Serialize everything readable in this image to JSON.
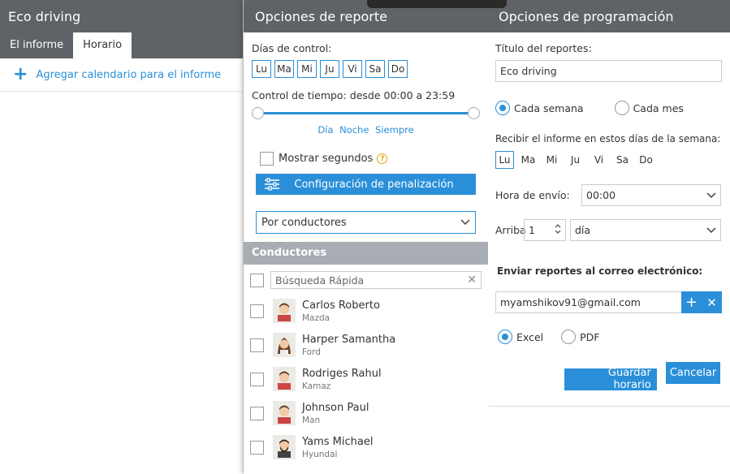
{
  "left": {
    "title": "Eco driving",
    "tabs": [
      {
        "label": "El informe"
      },
      {
        "label": "Horario"
      }
    ],
    "add_calendar": "Agregar calendario para el informe"
  },
  "report_options": {
    "title": "Opciones de reporte",
    "control_days_label": "Días de control:",
    "days": [
      "Lu",
      "Ma",
      "Mi",
      "Ju",
      "Vi",
      "Sa",
      "Do"
    ],
    "time_control": "Control de tiempo: desde 00:00 a 23:59",
    "modes": [
      "Día",
      "Noche",
      "Siempre"
    ],
    "show_seconds": "Mostrar segundos",
    "penalty_button": "Configuración de penalización",
    "group_by": "Por conductores",
    "drivers_header": "Conductores",
    "search_placeholder": "Búsqueda Rápida",
    "drivers": [
      {
        "name": "Carlos Roberto",
        "car": "Mazda"
      },
      {
        "name": "Harper Samantha",
        "car": "Ford"
      },
      {
        "name": "Rodriges Rahul",
        "car": "Kamaz"
      },
      {
        "name": "Johnson Paul",
        "car": "Man"
      },
      {
        "name": "Yams Michael",
        "car": "Hyundai"
      }
    ]
  },
  "schedule": {
    "title": "Opciones de programación",
    "report_title_label": "Título del reportes:",
    "report_title_value": "Eco driving",
    "every_week": "Cada semana",
    "every_month": "Cada mes",
    "receive_days_label": "Recibir el informe en estos días de la semana:",
    "week_days": [
      "Lu",
      "Ma",
      "Mi",
      "Ju",
      "Vi",
      "Sa",
      "Do"
    ],
    "send_time_label": "Hora de envío:",
    "send_time_value": "00:00",
    "above_label": "Arriba",
    "above_value": "1",
    "period_value": "día",
    "email_label": "Enviar reportes al correo electrónico:",
    "email_value": "myamshikov91@gmail.com",
    "format_excel": "Excel",
    "format_pdf": "PDF",
    "save_button": "Guardar horario",
    "cancel_button": "Cancelar"
  },
  "colors": {
    "accent": "#2a8fd8",
    "header": "#5f6266",
    "section": "#a8acb3"
  }
}
